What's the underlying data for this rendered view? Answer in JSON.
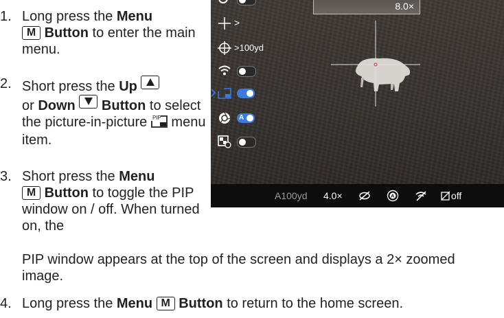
{
  "steps": [
    {
      "number": "1.",
      "pre": "Long press the ",
      "button_name": "Menu",
      "key": "M",
      "button_word": "Button",
      "post": " to enter the main menu."
    },
    {
      "number": "2.",
      "pre": "Short press the ",
      "up_name": "Up",
      "or_text": " or ",
      "down_name": "Down",
      "button_word": "Button",
      "post": " to select the picture-in-picture ",
      "post2": " menu item."
    },
    {
      "number": "3.",
      "pre": "Short press the ",
      "button_name": "Menu",
      "key": "M",
      "button_word": "Button",
      "post": " to toggle the PIP window on / off. When turned on, the"
    },
    {
      "continuation": "PIP window appears at the top of the screen and displays a 2× zoomed image."
    },
    {
      "number": "4.",
      "pre": "Long press the ",
      "button_name": "Menu",
      "key": "M",
      "button_word": "Button",
      "post": " to return to the home screen."
    }
  ],
  "pip_icon_text": "PIP",
  "device": {
    "pip_zoom": "8.0×",
    "menu": {
      "reticle_value": ">",
      "distance_value": ">100yd"
    },
    "status": {
      "distance": "A100yd",
      "zoom": "4.0×",
      "record": "off"
    },
    "colors": {
      "accent": "#3b7be0",
      "crosshair": "#e0e0e0",
      "center_dot": "#e03030"
    }
  }
}
